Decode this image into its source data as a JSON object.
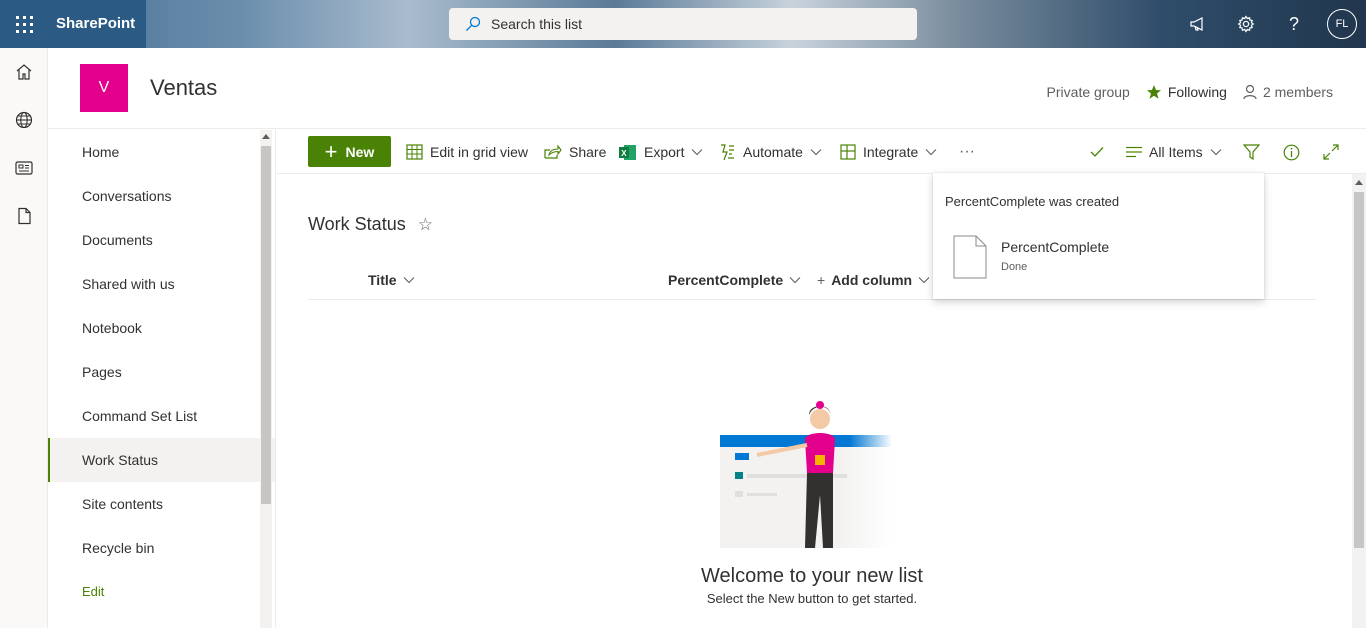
{
  "suitebar": {
    "app_name": "SharePoint",
    "search_placeholder": "Search this list",
    "avatar_initials": "FL",
    "icons": [
      "waffle-icon",
      "megaphone-icon",
      "gear-icon",
      "help-icon"
    ]
  },
  "app_rail": {
    "icons": [
      "home-icon",
      "globe-icon",
      "news-icon",
      "document-icon"
    ]
  },
  "site_header": {
    "logo_letter": "V",
    "logo_color": "#e3008c",
    "title": "Ventas",
    "privacy": "Private group",
    "following": "Following",
    "members": "2 members"
  },
  "left_nav": {
    "items": [
      {
        "label": "Home"
      },
      {
        "label": "Conversations"
      },
      {
        "label": "Documents"
      },
      {
        "label": "Shared with us"
      },
      {
        "label": "Notebook"
      },
      {
        "label": "Pages"
      },
      {
        "label": "Command Set List"
      },
      {
        "label": "Work Status",
        "selected": true
      },
      {
        "label": "Site contents"
      },
      {
        "label": "Recycle bin"
      }
    ],
    "edit": "Edit"
  },
  "command_bar": {
    "new": "New",
    "edit_grid": "Edit in grid view",
    "share": "Share",
    "export": "Export",
    "automate": "Automate",
    "integrate": "Integrate",
    "more": "···",
    "view": "All Items"
  },
  "list": {
    "title": "Work Status",
    "columns": {
      "title": "Title",
      "percent": "PercentComplete",
      "add": "Add column"
    },
    "empty_title": "Welcome to your new list",
    "empty_sub": "Select the New button to get started."
  },
  "toast": {
    "message": "PercentComplete was created",
    "file_name": "PercentComplete",
    "status": "Done"
  },
  "colors": {
    "accent_green": "#498205",
    "suite_blue": "#2b5b84"
  }
}
